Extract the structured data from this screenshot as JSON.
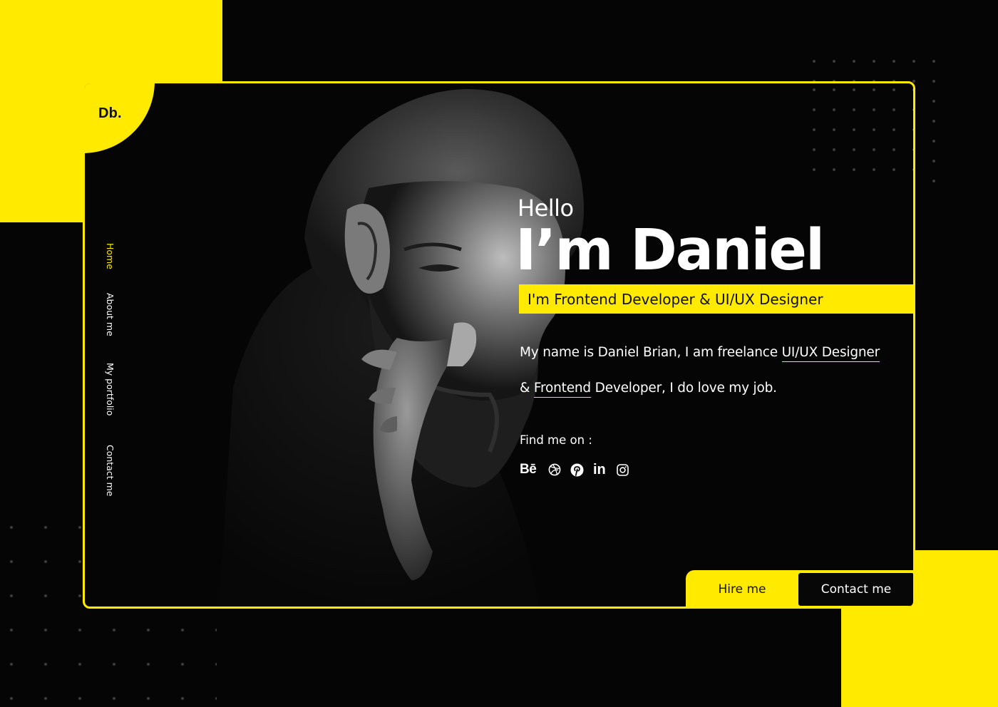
{
  "theme": {
    "accent": "#ffea00",
    "background": "#050505",
    "text": "#ffffff"
  },
  "brand": {
    "logo": "Db."
  },
  "nav": {
    "items": [
      {
        "label": "Home",
        "active": true
      },
      {
        "label": "About me",
        "active": false
      },
      {
        "label": "My portfolio",
        "active": false
      },
      {
        "label": "Contact me",
        "active": false
      }
    ]
  },
  "hero": {
    "greeting": "Hello",
    "name": "I’m Daniel",
    "role": "I'm Frontend Developer & UI/UX Designer",
    "bio": {
      "line1_before": "My name is Daniel Brian, I am freelance ",
      "line1_highlight": "UI/UX Designer",
      "line2_before": "& ",
      "line2_highlight": "Frontend",
      "line2_after": " Developer,  I do love my job."
    },
    "find_me": "Find me on :"
  },
  "socials": [
    {
      "icon": "behance-icon",
      "text": "Bē"
    },
    {
      "icon": "dribbble-icon"
    },
    {
      "icon": "pinterest-icon"
    },
    {
      "icon": "linkedin-icon",
      "text": "in"
    },
    {
      "icon": "instagram-icon"
    }
  ],
  "actions": {
    "hire": "Hire me",
    "contact": "Contact me"
  }
}
